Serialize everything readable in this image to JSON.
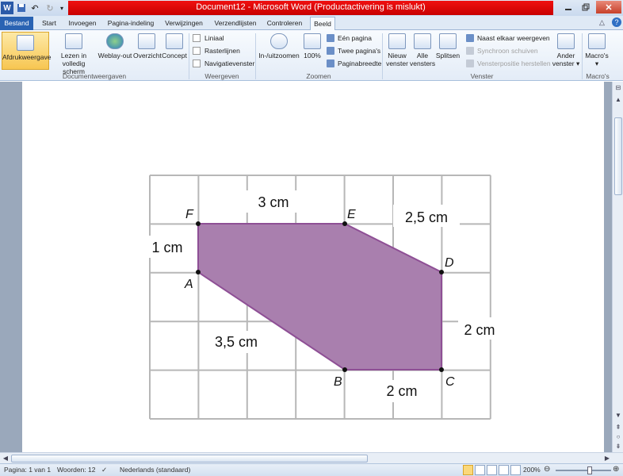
{
  "window": {
    "title": "Document12 - Microsoft Word (Productactivering is mislukt)",
    "controls": [
      "minimize-icon",
      "restore-icon",
      "close-icon"
    ]
  },
  "quick_access": [
    "word-logo-icon",
    "save-icon",
    "undo-icon",
    "redo-icon",
    "customize-icon"
  ],
  "tabs": [
    {
      "label": "Bestand"
    },
    {
      "label": "Start"
    },
    {
      "label": "Invoegen"
    },
    {
      "label": "Pagina-indeling"
    },
    {
      "label": "Verwijzingen"
    },
    {
      "label": "Verzendlijsten"
    },
    {
      "label": "Controleren"
    },
    {
      "label": "Beeld"
    }
  ],
  "ribbon": {
    "documentweergaven": {
      "group_label": "Documentweergaven",
      "afdrukweergave": "Afdrukweergave",
      "lezen_line1": "Lezen in",
      "lezen_line2": "volledig scherm",
      "weblay": "Weblay-out",
      "overzicht": "Overzicht",
      "concept": "Concept"
    },
    "weergeven": {
      "group_label": "Weergeven",
      "liniaal": "Liniaal",
      "rasterlijnen": "Rasterlijnen",
      "navigatievenster": "Navigatievenster"
    },
    "zoomen": {
      "group_label": "Zoomen",
      "inuitzoomen": "In-/uitzoomen",
      "honderd": "100%",
      "een_pagina": "Eén pagina",
      "twee_paginas": "Twee pagina's",
      "paginabreedte": "Paginabreedte"
    },
    "venster": {
      "group_label": "Venster",
      "nieuw_line1": "Nieuw",
      "nieuw_line2": "venster",
      "alle_line1": "Alle",
      "alle_line2": "vensters",
      "splitsen": "Splitsen",
      "naast_elkaar": "Naast elkaar weergeven",
      "synchroon": "Synchroon schuiven",
      "vensterpositie": "Vensterpositie herstellen",
      "ander_line1": "Ander",
      "ander_line2": "venster ▾"
    },
    "macros": {
      "group_label": "Macro's",
      "macros_label": "Macro's",
      "macros_arrow": "▾"
    }
  },
  "figure": {
    "fill_color": "#a97fae",
    "edge_color": "#8e4f95",
    "grid_color": "#b7b7b7",
    "labels": {
      "fe": "3 cm",
      "ed": "2,5 cm",
      "af": "1 cm",
      "dc": "2 cm",
      "ab": "3,5 cm",
      "bc": "2 cm"
    },
    "vertices": {
      "a": "A",
      "b": "B",
      "c": "C",
      "d": "D",
      "e": "E",
      "f": "F"
    }
  },
  "statusbar": {
    "page": "Pagina: 1 van 1",
    "words": "Woorden: 12",
    "language": "Nederlands (standaard)",
    "zoom": "200%",
    "zoom_fraction": 0.62
  }
}
